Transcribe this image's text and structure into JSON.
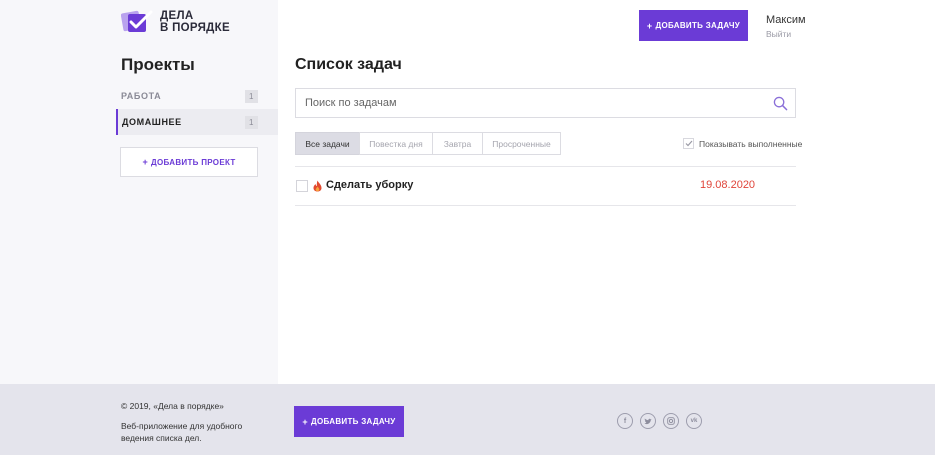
{
  "brand": {
    "logo_line1": "ДЕЛА",
    "logo_line2": "В ПОРЯДКЕ",
    "accent_color": "#6b3bd6"
  },
  "sidebar": {
    "title": "Проекты",
    "projects": [
      {
        "label": "РАБОТА",
        "count": "1",
        "active": false
      },
      {
        "label": "ДОМАШНЕЕ",
        "count": "1",
        "active": true
      }
    ],
    "add_project_label": "ДОБАВИТЬ ПРОЕКТ"
  },
  "header": {
    "add_task_label": "ДОБАВИТЬ ЗАДАЧУ",
    "user_name": "Максим",
    "logout_label": "Выйти"
  },
  "main": {
    "title": "Список задач",
    "search": {
      "placeholder": "Поиск по задачам",
      "value": ""
    },
    "filters": [
      {
        "label": "Все задачи",
        "active": true
      },
      {
        "label": "Повестка дня",
        "active": false
      },
      {
        "label": "Завтра",
        "active": false
      },
      {
        "label": "Просроченные",
        "active": false
      }
    ],
    "show_completed": {
      "label": "Показывать выполненные",
      "checked": true
    },
    "tasks": [
      {
        "name": "Сделать уборку",
        "date": "19.08.2020",
        "done": false,
        "important": true,
        "date_color": "#e0453a"
      }
    ]
  },
  "footer": {
    "copyright": "© 2019, «Дела в порядке»",
    "description": "Веб-приложение для удобного ведения списка дел.",
    "add_task_label": "ДОБАВИТЬ ЗАДАЧУ",
    "socials": [
      "facebook-icon",
      "twitter-icon",
      "instagram-icon",
      "vk-icon"
    ]
  }
}
